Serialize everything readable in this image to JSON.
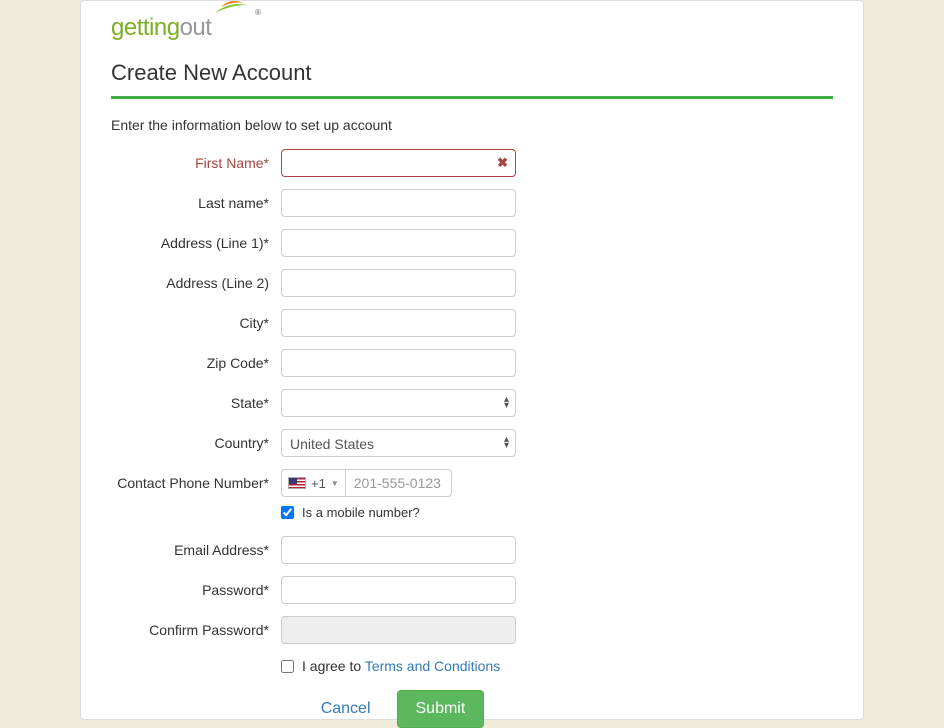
{
  "brand": {
    "part1": "getting",
    "part2": "out"
  },
  "title": "Create New Account",
  "instruction": "Enter the information below to set up account",
  "fields": {
    "first_name": {
      "label": "First Name*",
      "value": ""
    },
    "last_name": {
      "label": "Last name*",
      "value": ""
    },
    "address1": {
      "label": "Address (Line 1)*",
      "value": ""
    },
    "address2": {
      "label": "Address (Line 2)",
      "value": ""
    },
    "city": {
      "label": "City*",
      "value": ""
    },
    "zip": {
      "label": "Zip Code*",
      "value": ""
    },
    "state": {
      "label": "State*",
      "value": ""
    },
    "country": {
      "label": "Country*",
      "value": "United States"
    },
    "phone": {
      "label": "Contact Phone Number*",
      "prefix": "+1",
      "placeholder": "201-555-0123",
      "value": ""
    },
    "mobile_check": {
      "label": "Is a mobile number?",
      "checked": true
    },
    "email": {
      "label": "Email Address*",
      "value": ""
    },
    "password": {
      "label": "Password*",
      "value": ""
    },
    "confirm_password": {
      "label": "Confirm Password*",
      "value": ""
    }
  },
  "terms": {
    "prefix": "I agree to ",
    "link": "Terms and Conditions",
    "checked": false
  },
  "actions": {
    "cancel": "Cancel",
    "submit": "Submit"
  }
}
